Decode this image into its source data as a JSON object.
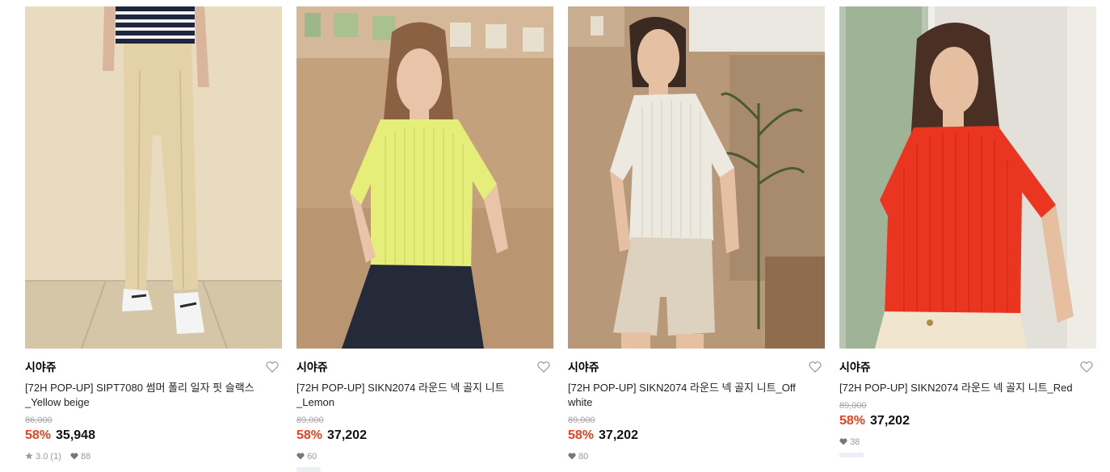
{
  "products": [
    {
      "brand": "시야쥬",
      "title": "[72H POP-UP] SIPT7080 썸머 폴리 일자 핏 슬랙스_Yellow beige",
      "original_price": "86,000",
      "discount": "58%",
      "price": "35,948",
      "rating": "3.0",
      "review_count": "(1)",
      "likes": "88",
      "image_icon": "model-photo",
      "shirt_color": "#e3d2a8"
    },
    {
      "brand": "시야쥬",
      "title": "[72H POP-UP] SIKN2074 라운드 넥 골지 니트_Lemon",
      "original_price": "89,000",
      "discount": "58%",
      "price": "37,202",
      "likes": "60",
      "image_icon": "model-photo",
      "shirt_color": "#e6ee7a"
    },
    {
      "brand": "시야쥬",
      "title": "[72H POP-UP] SIKN2074 라운드 넥 골지 니트_Off white",
      "original_price": "89,000",
      "discount": "58%",
      "price": "37,202",
      "likes": "80",
      "image_icon": "model-photo",
      "shirt_color": "#ece9e1"
    },
    {
      "brand": "시야쥬",
      "title": "[72H POP-UP] SIKN2074 라운드 넥 골지 니트_Red",
      "original_price": "89,000",
      "discount": "58%",
      "price": "37,202",
      "likes": "38",
      "image_icon": "model-photo",
      "shirt_color": "#ea3520"
    }
  ],
  "colors": {
    "discount": "#f0401e",
    "strike_price": "#a5a5a5",
    "meta_text": "#999999"
  },
  "icons": {
    "wishlist": "heart-outline-icon",
    "like": "heart-filled-icon",
    "rating": "star-icon"
  }
}
